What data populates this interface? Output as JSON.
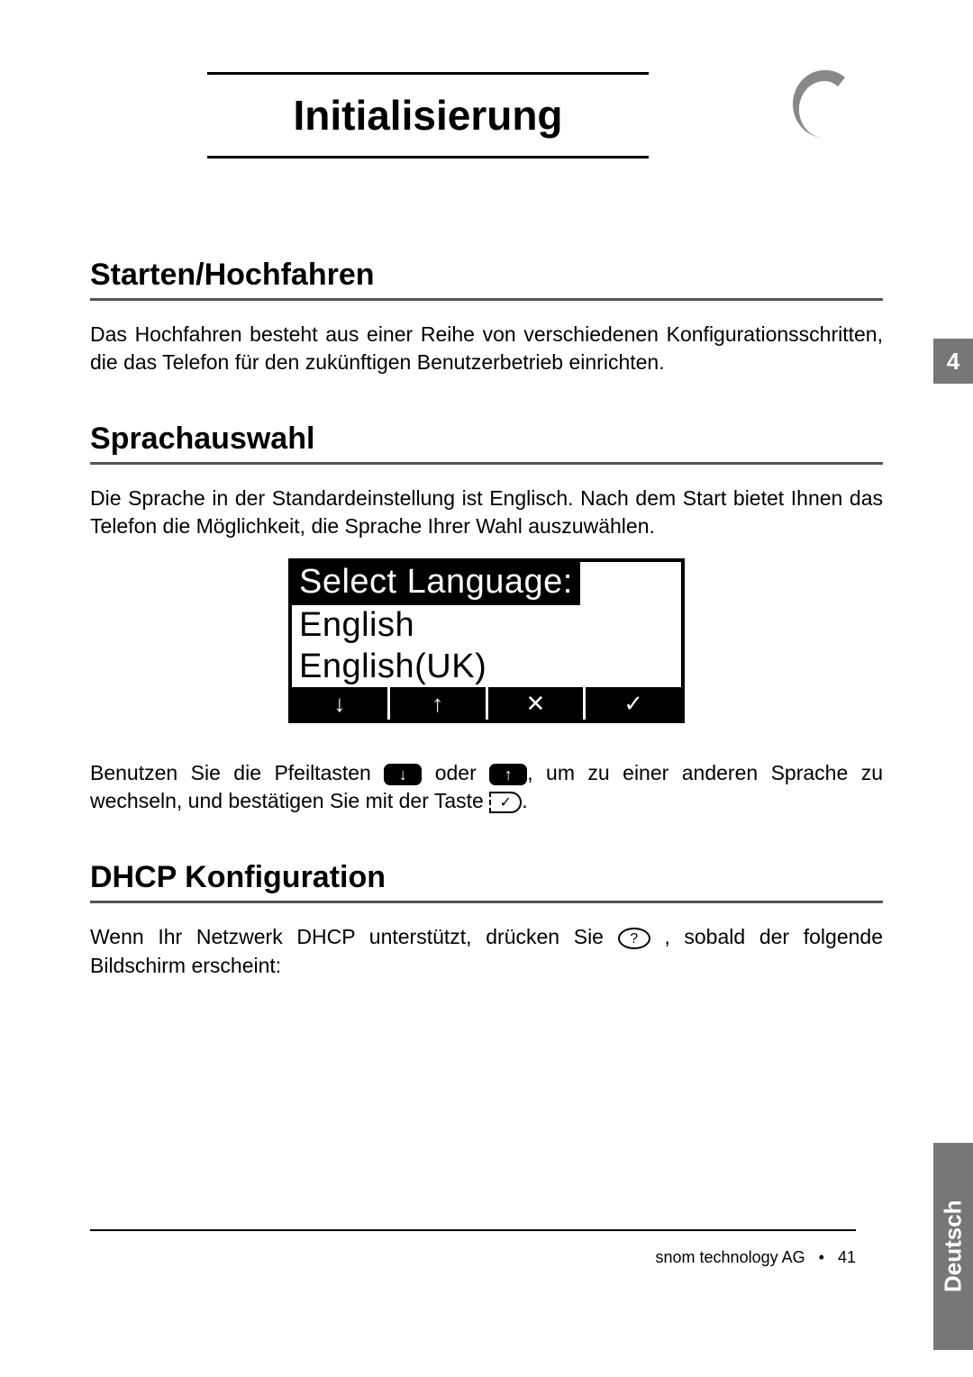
{
  "page_title": "Initialisierung",
  "chapter_tab": "4",
  "language_tab": "Deutsch",
  "sections": {
    "s1": {
      "heading": "Starten/Hochfahren",
      "body": "Das Hochfahren besteht aus einer Reihe von verschiedenen Konfigurationsschritten, die das Telefon für den zukünftigen Benutzerbetrieb einrichten."
    },
    "s2": {
      "heading": "Sprachauswahl",
      "body1": "Die Sprache in der Standardeinstellung ist Englisch. Nach dem Start bietet Ihnen das Telefon die Möglichkeit, die Sprache Ihrer Wahl auszuwählen.",
      "lcd": {
        "title": "Select Language:",
        "line1": "English",
        "line2": "English(UK)",
        "softkeys": [
          "↓",
          "↑",
          "✕",
          "✓"
        ]
      },
      "body2_parts": {
        "p1": "Benutzen Sie die Pfeiltasten ",
        "p2": " oder ",
        "p3": ", um zu einer anderen Sprache zu wechseln, und  bestätigen Sie mit der Taste ",
        "p4": "."
      }
    },
    "s3": {
      "heading": "DHCP Konfiguration",
      "body_parts": {
        "p1": "Wenn Ihr Netzwerk DHCP unterstützt, drücken Sie ",
        "p2": " , sobald der folgende Bildschirm erscheint:"
      }
    }
  },
  "icons": {
    "arrow_down_key": "↓",
    "arrow_up_key": "↑",
    "check_key": "✓",
    "question_key": "?"
  },
  "footer": {
    "company": "snom technology AG",
    "separator": "•",
    "page_number": "41"
  }
}
